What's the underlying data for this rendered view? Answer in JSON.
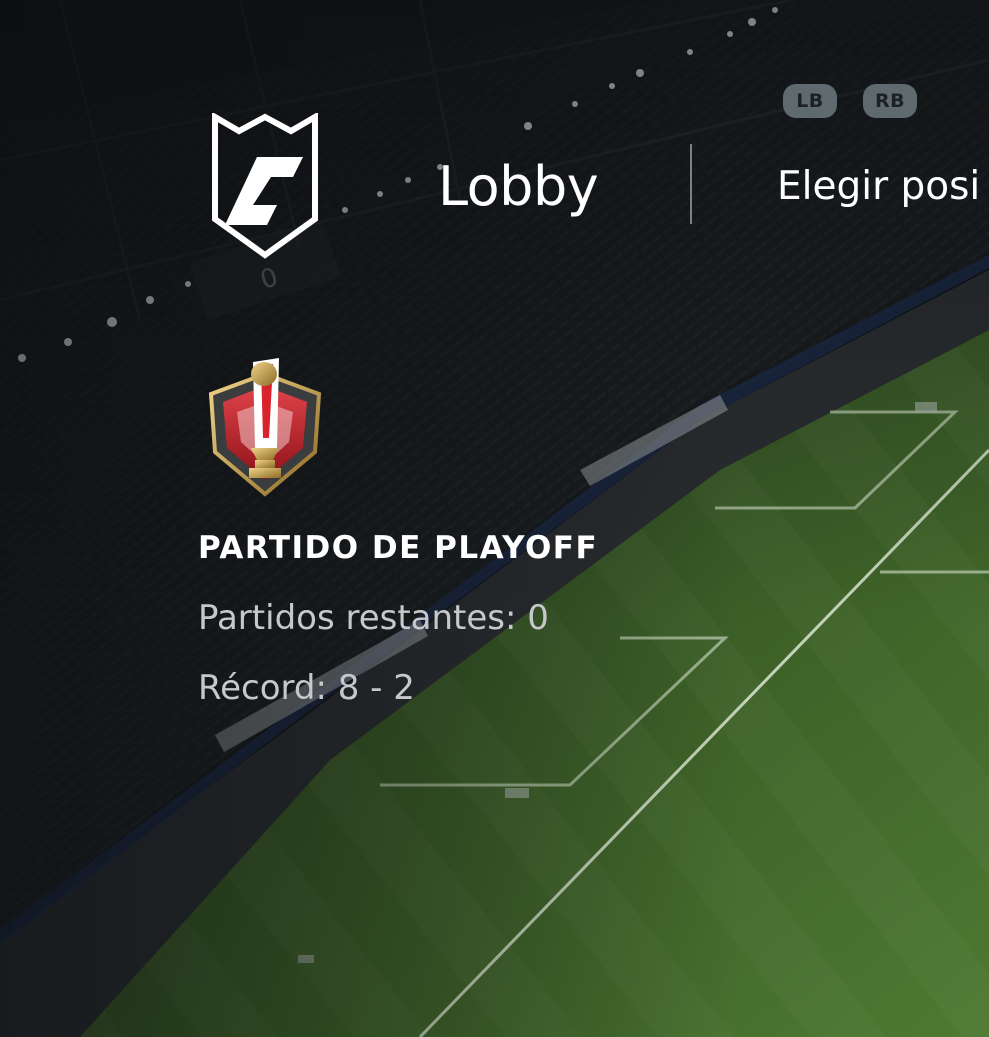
{
  "controls": {
    "lb_label": "LB",
    "rb_label": "RB"
  },
  "header": {
    "logo_icon": "clubs-shield-logo-icon",
    "tabs": [
      {
        "label": "Lobby",
        "active": true
      },
      {
        "label": "Elegir posi"
      }
    ]
  },
  "match": {
    "badge_icon": "playoff-trophy-badge-icon",
    "title": "PARTIDO DE PLAYOFF",
    "remaining": "Partidos restantes: 0",
    "record": "Récord: 8 - 2"
  },
  "colors": {
    "background": "#0b0d0f",
    "pitch_dark": "#2f4a22",
    "pitch_light": "#4f7a32",
    "text_primary": "#ffffff",
    "text_secondary": "#c6c9cb",
    "shoulder_button": "#5f6a6e",
    "badge_red": "#c8232c",
    "badge_gold": "#c9a14a"
  }
}
